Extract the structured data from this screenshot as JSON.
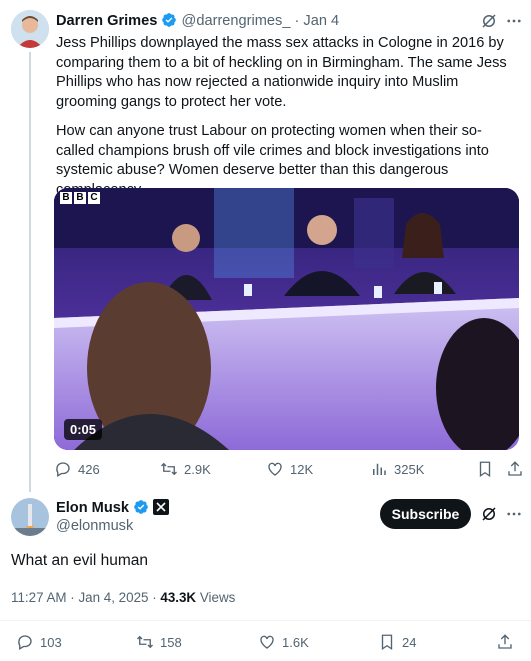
{
  "first_tweet": {
    "author_name": "Darren Grimes",
    "handle_date": "@darrengrimes_ · Jan 4",
    "text_p1": "Jess Phillips downplayed the mass sex attacks in Cologne in 2016 by comparing them to a bit of heckling on in Birmingham. The same Jess Phillips who has now rejected a nationwide inquiry into Muslim grooming gangs to protect her vote.",
    "text_p2": "How can anyone trust Labour on protecting women when their so-called champions brush off vile crimes and block investigations into systemic abuse? Women deserve better than this dangerous complacency.",
    "video": {
      "logo": [
        "B",
        "B",
        "C"
      ],
      "duration": "0:05"
    },
    "stats": {
      "replies": "426",
      "reposts": "2.9K",
      "likes": "12K",
      "views": "325K"
    }
  },
  "main_tweet": {
    "author_name": "Elon Musk",
    "handle": "@elonmusk",
    "subscribe_label": "Subscribe",
    "text": "What an evil human",
    "time_date": "11:27 AM · Jan 4, 2025 · ",
    "views_count": "43.3K",
    "views_label": " Views",
    "stats": {
      "replies": "103",
      "reposts": "158",
      "likes": "1.6K",
      "bookmarks": "24"
    }
  },
  "colors": {
    "verified": "#1d9bf0",
    "text": "#0f1419",
    "muted": "#536471",
    "divider": "#eff3f4"
  },
  "icons": [
    "grok-icon",
    "more-icon",
    "reply-icon",
    "repost-icon",
    "like-icon",
    "views-icon",
    "bookmark-icon",
    "share-icon",
    "verified-badge-icon",
    "x-affiliate-icon"
  ]
}
